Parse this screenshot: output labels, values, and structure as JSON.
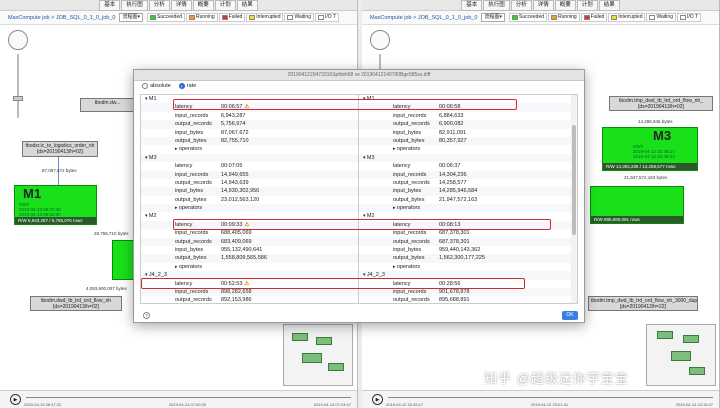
{
  "topbar_tabs": [
    "基本",
    "执行图",
    "分析",
    "详情",
    "概要",
    "计划",
    "结果"
  ],
  "left": {
    "breadcrumb": "MaxCompute job > JOB_SQL_0_1_0_job_0",
    "layout_select": "流程图▾",
    "legend": [
      {
        "label": "Succeeded",
        "color": "#19e019"
      },
      {
        "label": "Running",
        "color": "#f0a020"
      },
      {
        "label": "Failed",
        "color": "#e03030"
      },
      {
        "label": "Interrupted",
        "color": "#f0e020"
      },
      {
        "label": "Waiting",
        "color": "#ffffff"
      },
      {
        "label": "I/O T",
        "color": "#ffffff"
      }
    ],
    "nodes": {
      "src1": "tbodm.dw...",
      "src2_a": "tbodsr.ic_to_logistics_order_nh",
      "src2_b": "[ds=20190413/h=02]",
      "m1_title": "M1",
      "m1_meta_1": "0/0/0",
      "m1_meta_2": "2019-04-13 06:47:40",
      "m1_meta_3": "2019-04-13 06:50:00",
      "m1_rw": "R/W   6,943,287 / 5,755,076 rows",
      "dst_a": "tbodm.dwd_tb_trd_ord_flow_nh",
      "dst_b": "[ds=20190413/h=02]"
    },
    "edges": {
      "e1": "87,067,672 bytes",
      "e2": "28,755,710 bytes",
      "e3": "4,093,600,007 bytes"
    },
    "timeline": [
      "2019-04-13 06:47:22",
      "2019-04-13 07:00:30",
      "2019-04-13 07:24:47"
    ]
  },
  "right": {
    "breadcrumb": "MaxCompute job > JOB_SQL_0_1_0_job_0",
    "layout_select": "流程图▾",
    "legend": [
      {
        "label": "Succeeded",
        "color": "#19e019"
      },
      {
        "label": "Running",
        "color": "#f0a020"
      },
      {
        "label": "Failed",
        "color": "#e03030"
      },
      {
        "label": "Interrupted",
        "color": "#f0e020"
      },
      {
        "label": "Waiting",
        "color": "#ffffff"
      },
      {
        "label": "I/O T",
        "color": "#ffffff"
      }
    ],
    "nodes": {
      "src1_a": "tbodm.tmp_dwd_tb_trd_ord_flow_nh_",
      "src1_b": "[ds=20190413/h=02]",
      "src1_edge": "14,286,946 bytes",
      "m3_title": "M3",
      "m3_meta_1": "0/0/0",
      "m3_meta_2": "2019-04-12 22:45:17",
      "m3_meta_3": "2019-04-12 22:45:24",
      "m3_rw": "R/W   14,304,236 / 14,258,577 rows",
      "edge_m3": "21,947,572,163 bytes",
      "green2_rw": "R/W   886,680,091 rows",
      "dst_a": "tbodm.tmp_dwd_tb_trd_ord_flow_nh_3000_dup",
      "dst_b": "[ds=20190412/h=22]"
    },
    "timeline": [
      "2019-04-12 22:45:17",
      "2019-04-12 23:01:41",
      "2019-04-12 23:15:47"
    ]
  },
  "dialog": {
    "title": "2019041220473316Spfdsh68 vs 20190412140790Bge585sx.diff",
    "radio_absolute": "absolute",
    "radio_rate": "rate",
    "warn_icon": "⚠",
    "left_rows": [
      {
        "k": "M1",
        "v": "",
        "lvl": 0,
        "kind": "group"
      },
      {
        "k": "latency",
        "v": "00:06:57",
        "lvl": 1,
        "warn": true
      },
      {
        "k": "input_records",
        "v": "6,943,287",
        "lvl": 1
      },
      {
        "k": "output_records",
        "v": "5,756,974",
        "lvl": 1
      },
      {
        "k": "input_bytes",
        "v": "87,067,672",
        "lvl": 1
      },
      {
        "k": "output_bytes",
        "v": "82,755,710",
        "lvl": 1
      },
      {
        "k": "operators",
        "v": "",
        "lvl": 1,
        "kind": "collapsed"
      },
      {
        "k": "M3",
        "v": "",
        "lvl": 0,
        "kind": "group"
      },
      {
        "k": "latency",
        "v": "00:07:05",
        "lvl": 1
      },
      {
        "k": "input_records",
        "v": "14,949,655",
        "lvl": 1
      },
      {
        "k": "output_records",
        "v": "14,943,639",
        "lvl": 1
      },
      {
        "k": "input_bytes",
        "v": "14,930,302,956",
        "lvl": 1
      },
      {
        "k": "output_bytes",
        "v": "23,012,563,120",
        "lvl": 1
      },
      {
        "k": "operators",
        "v": "",
        "lvl": 1,
        "kind": "collapsed"
      },
      {
        "k": "M2",
        "v": "",
        "lvl": 0,
        "kind": "group"
      },
      {
        "k": "latency",
        "v": "00:09:33",
        "lvl": 1,
        "warn": true
      },
      {
        "k": "input_records",
        "v": "688,405,069",
        "lvl": 1
      },
      {
        "k": "output_records",
        "v": "683,409,069",
        "lvl": 1
      },
      {
        "k": "input_bytes",
        "v": "955,132,490,641",
        "lvl": 1
      },
      {
        "k": "output_bytes",
        "v": "1,558,809,565,586",
        "lvl": 1
      },
      {
        "k": "operators",
        "v": "",
        "lvl": 1,
        "kind": "collapsed"
      },
      {
        "k": "J4_2_3",
        "v": "",
        "lvl": 0,
        "kind": "group"
      },
      {
        "k": "latency",
        "v": "00:52:53",
        "lvl": 1,
        "warn": true
      },
      {
        "k": "input_records",
        "v": "898,282,658",
        "lvl": 1
      },
      {
        "k": "output_records",
        "v": "892,153,986",
        "lvl": 1
      }
    ],
    "right_rows": [
      {
        "k": "M1",
        "v": "",
        "lvl": 0,
        "kind": "group"
      },
      {
        "k": "latency",
        "v": "00:06:58",
        "lvl": 1
      },
      {
        "k": "input_records",
        "v": "6,884,633",
        "lvl": 1
      },
      {
        "k": "output_records",
        "v": "6,900,082",
        "lvl": 1
      },
      {
        "k": "input_bytes",
        "v": "82,911,091",
        "lvl": 1
      },
      {
        "k": "output_bytes",
        "v": "80,357,927",
        "lvl": 1
      },
      {
        "k": "operators",
        "v": "",
        "lvl": 1,
        "kind": "collapsed"
      },
      {
        "k": "M3",
        "v": "",
        "lvl": 0,
        "kind": "group"
      },
      {
        "k": "latency",
        "v": "00:06:37",
        "lvl": 1
      },
      {
        "k": "input_records",
        "v": "14,304,236",
        "lvl": 1
      },
      {
        "k": "output_records",
        "v": "14,258,577",
        "lvl": 1
      },
      {
        "k": "input_bytes",
        "v": "14,285,946,584",
        "lvl": 1
      },
      {
        "k": "output_bytes",
        "v": "21,947,572,163",
        "lvl": 1
      },
      {
        "k": "operators",
        "v": "",
        "lvl": 1,
        "kind": "collapsed"
      },
      {
        "k": "M2",
        "v": "",
        "lvl": 0,
        "kind": "group"
      },
      {
        "k": "latency",
        "v": "00:08:13",
        "lvl": 1
      },
      {
        "k": "input_records",
        "v": "687,378,301",
        "lvl": 1
      },
      {
        "k": "output_records",
        "v": "687,378,301",
        "lvl": 1
      },
      {
        "k": "input_bytes",
        "v": "959,440,143,362",
        "lvl": 1
      },
      {
        "k": "output_bytes",
        "v": "1,562,300,177,225",
        "lvl": 1
      },
      {
        "k": "operators",
        "v": "",
        "lvl": 1,
        "kind": "collapsed"
      },
      {
        "k": "J4_2_3",
        "v": "",
        "lvl": 0,
        "kind": "group"
      },
      {
        "k": "latency",
        "v": "00:28:56",
        "lvl": 1
      },
      {
        "k": "input_records",
        "v": "901,678,878",
        "lvl": 1
      },
      {
        "k": "output_records",
        "v": "895,688,891",
        "lvl": 1
      }
    ],
    "ok_label": "OK",
    "help_label": "?"
  },
  "watermark": "知乎 @超级迷你宇宝宝",
  "colors": {
    "highlight": "#d42a2a",
    "accent": "#3a7fe6",
    "node_green": "#19e019"
  }
}
